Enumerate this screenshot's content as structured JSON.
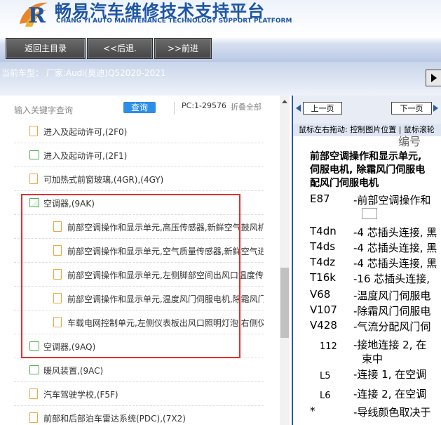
{
  "header": {
    "title_cn": "畅易汽车维修技术支持平台",
    "title_en": "CHANG YI AUTO MAINTENANCE TECHNOLOGY SUPPORT PLATFORM"
  },
  "nav": {
    "home": "返回主目录",
    "back": "<<后退.",
    "forward": ">>前进"
  },
  "car": {
    "label": "当前车型： 厂家:Audi(奥迪)Q52020-2021"
  },
  "search": {
    "placeholder": "输入关键字查询",
    "button": "查询",
    "pc": "PC:1-29576",
    "collapse": "折叠全部"
  },
  "tree": [
    {
      "type": "doc",
      "label": "进入及起动许可,(2F0)",
      "indent": 0
    },
    {
      "type": "folder",
      "label": "进入及起动许可,(2F1)",
      "indent": 0
    },
    {
      "type": "doc",
      "label": "可加热式前窗玻璃,(4GR),(4GY)",
      "indent": 0
    },
    {
      "type": "folder-open",
      "label": "空调器,(9AK)",
      "indent": 0
    },
    {
      "type": "doc",
      "label": "前部空调操作和显示单元,高压传感器,新鲜空气鼓风机",
      "indent": 1
    },
    {
      "type": "doc",
      "label": "前部空调操作和显示单元,空气质量传感器,新鲜空气进",
      "indent": 1
    },
    {
      "type": "doc",
      "label": "前部空调操作和显示单元,左侧脚部空间出风口温度传",
      "indent": 1
    },
    {
      "type": "doc",
      "label": "前部空调操作和显示单元,温度风门伺服电机,除霜风门",
      "indent": 1
    },
    {
      "type": "doc",
      "label": "车载电网控制单元,左侧仪表板出风口照明灯泡,右侧仪",
      "indent": 1
    },
    {
      "type": "folder",
      "label": "空调器,(9AQ)",
      "indent": 0
    },
    {
      "type": "folder",
      "label": "暖风装置,(9AC)",
      "indent": 0
    },
    {
      "type": "doc",
      "label": "汽车驾驶学校,(F5F)",
      "indent": 0
    },
    {
      "type": "doc",
      "label": "前部和后部泊车雷达系统(PDC),(7X2)",
      "indent": 0
    }
  ],
  "viewer": {
    "prev": "上一页",
    "next": "下一页",
    "tip": "鼠标左右拖动: 控制图片位置 | 鼠标滚轮",
    "heading_partial": "编号",
    "title_lines": [
      "前部空调操作和显示单元,",
      "伺服电机, 除霜风门伺服电",
      "配风门伺服电机"
    ],
    "legend": [
      {
        "code": "E87",
        "desc": "-前部空调操作和"
      },
      {
        "code": "T4dn",
        "desc": "-4 芯插头连接, 黑"
      },
      {
        "code": "T4ds",
        "desc": "-4 芯插头连接, 黑"
      },
      {
        "code": "T4dz",
        "desc": "-4 芯插头连接, 黑"
      },
      {
        "code": "T16k",
        "desc": "-16 芯插头连接,"
      },
      {
        "code": "V68",
        "desc": "-温度风门伺服电"
      },
      {
        "code": "V107",
        "desc": "-除霜风门伺服电"
      },
      {
        "code": "V428",
        "desc": "-气流分配风门伺"
      },
      {
        "code": "112",
        "desc": "-接地连接 2, 在"
      },
      {
        "code": "",
        "desc": "束中"
      },
      {
        "code": "L5",
        "desc": "-连接 1, 在空调"
      },
      {
        "code": "L6",
        "desc": "-连接 2, 在空调"
      },
      {
        "code": "*",
        "desc": "-导线颜色取决于"
      }
    ]
  }
}
